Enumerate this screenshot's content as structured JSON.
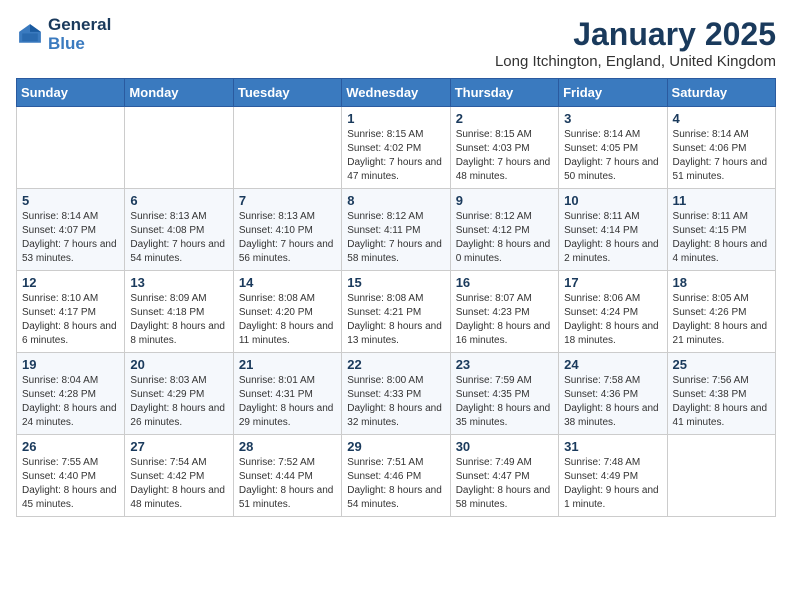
{
  "header": {
    "logo_line1": "General",
    "logo_line2": "Blue",
    "month_year": "January 2025",
    "location": "Long Itchington, England, United Kingdom"
  },
  "weekdays": [
    "Sunday",
    "Monday",
    "Tuesday",
    "Wednesday",
    "Thursday",
    "Friday",
    "Saturday"
  ],
  "weeks": [
    [
      {
        "day": "",
        "info": ""
      },
      {
        "day": "",
        "info": ""
      },
      {
        "day": "",
        "info": ""
      },
      {
        "day": "1",
        "info": "Sunrise: 8:15 AM\nSunset: 4:02 PM\nDaylight: 7 hours and 47 minutes."
      },
      {
        "day": "2",
        "info": "Sunrise: 8:15 AM\nSunset: 4:03 PM\nDaylight: 7 hours and 48 minutes."
      },
      {
        "day": "3",
        "info": "Sunrise: 8:14 AM\nSunset: 4:05 PM\nDaylight: 7 hours and 50 minutes."
      },
      {
        "day": "4",
        "info": "Sunrise: 8:14 AM\nSunset: 4:06 PM\nDaylight: 7 hours and 51 minutes."
      }
    ],
    [
      {
        "day": "5",
        "info": "Sunrise: 8:14 AM\nSunset: 4:07 PM\nDaylight: 7 hours and 53 minutes."
      },
      {
        "day": "6",
        "info": "Sunrise: 8:13 AM\nSunset: 4:08 PM\nDaylight: 7 hours and 54 minutes."
      },
      {
        "day": "7",
        "info": "Sunrise: 8:13 AM\nSunset: 4:10 PM\nDaylight: 7 hours and 56 minutes."
      },
      {
        "day": "8",
        "info": "Sunrise: 8:12 AM\nSunset: 4:11 PM\nDaylight: 7 hours and 58 minutes."
      },
      {
        "day": "9",
        "info": "Sunrise: 8:12 AM\nSunset: 4:12 PM\nDaylight: 8 hours and 0 minutes."
      },
      {
        "day": "10",
        "info": "Sunrise: 8:11 AM\nSunset: 4:14 PM\nDaylight: 8 hours and 2 minutes."
      },
      {
        "day": "11",
        "info": "Sunrise: 8:11 AM\nSunset: 4:15 PM\nDaylight: 8 hours and 4 minutes."
      }
    ],
    [
      {
        "day": "12",
        "info": "Sunrise: 8:10 AM\nSunset: 4:17 PM\nDaylight: 8 hours and 6 minutes."
      },
      {
        "day": "13",
        "info": "Sunrise: 8:09 AM\nSunset: 4:18 PM\nDaylight: 8 hours and 8 minutes."
      },
      {
        "day": "14",
        "info": "Sunrise: 8:08 AM\nSunset: 4:20 PM\nDaylight: 8 hours and 11 minutes."
      },
      {
        "day": "15",
        "info": "Sunrise: 8:08 AM\nSunset: 4:21 PM\nDaylight: 8 hours and 13 minutes."
      },
      {
        "day": "16",
        "info": "Sunrise: 8:07 AM\nSunset: 4:23 PM\nDaylight: 8 hours and 16 minutes."
      },
      {
        "day": "17",
        "info": "Sunrise: 8:06 AM\nSunset: 4:24 PM\nDaylight: 8 hours and 18 minutes."
      },
      {
        "day": "18",
        "info": "Sunrise: 8:05 AM\nSunset: 4:26 PM\nDaylight: 8 hours and 21 minutes."
      }
    ],
    [
      {
        "day": "19",
        "info": "Sunrise: 8:04 AM\nSunset: 4:28 PM\nDaylight: 8 hours and 24 minutes."
      },
      {
        "day": "20",
        "info": "Sunrise: 8:03 AM\nSunset: 4:29 PM\nDaylight: 8 hours and 26 minutes."
      },
      {
        "day": "21",
        "info": "Sunrise: 8:01 AM\nSunset: 4:31 PM\nDaylight: 8 hours and 29 minutes."
      },
      {
        "day": "22",
        "info": "Sunrise: 8:00 AM\nSunset: 4:33 PM\nDaylight: 8 hours and 32 minutes."
      },
      {
        "day": "23",
        "info": "Sunrise: 7:59 AM\nSunset: 4:35 PM\nDaylight: 8 hours and 35 minutes."
      },
      {
        "day": "24",
        "info": "Sunrise: 7:58 AM\nSunset: 4:36 PM\nDaylight: 8 hours and 38 minutes."
      },
      {
        "day": "25",
        "info": "Sunrise: 7:56 AM\nSunset: 4:38 PM\nDaylight: 8 hours and 41 minutes."
      }
    ],
    [
      {
        "day": "26",
        "info": "Sunrise: 7:55 AM\nSunset: 4:40 PM\nDaylight: 8 hours and 45 minutes."
      },
      {
        "day": "27",
        "info": "Sunrise: 7:54 AM\nSunset: 4:42 PM\nDaylight: 8 hours and 48 minutes."
      },
      {
        "day": "28",
        "info": "Sunrise: 7:52 AM\nSunset: 4:44 PM\nDaylight: 8 hours and 51 minutes."
      },
      {
        "day": "29",
        "info": "Sunrise: 7:51 AM\nSunset: 4:46 PM\nDaylight: 8 hours and 54 minutes."
      },
      {
        "day": "30",
        "info": "Sunrise: 7:49 AM\nSunset: 4:47 PM\nDaylight: 8 hours and 58 minutes."
      },
      {
        "day": "31",
        "info": "Sunrise: 7:48 AM\nSunset: 4:49 PM\nDaylight: 9 hours and 1 minute."
      },
      {
        "day": "",
        "info": ""
      }
    ]
  ]
}
